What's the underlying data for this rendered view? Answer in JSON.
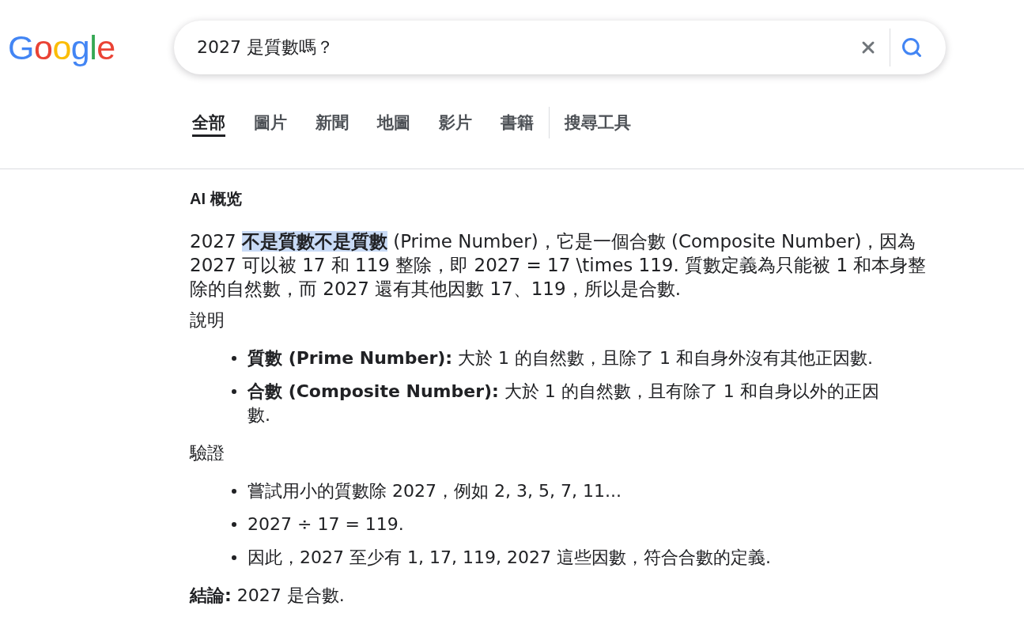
{
  "header": {
    "logo": "Google",
    "search": {
      "value": "2027 是質數嗎？"
    }
  },
  "tabs": [
    {
      "label": "全部",
      "kind": "category",
      "selected": true
    },
    {
      "label": "圖片",
      "kind": "category",
      "selected": false
    },
    {
      "label": "新聞",
      "kind": "category",
      "selected": false
    },
    {
      "label": "地圖",
      "kind": "category",
      "selected": false
    },
    {
      "label": "影片",
      "kind": "category",
      "selected": false
    },
    {
      "label": "書籍",
      "kind": "category",
      "selected": false
    },
    {
      "label": "搜尋工具",
      "kind": "tools",
      "selected": false
    }
  ],
  "ai_overview": {
    "title": "AI 概览",
    "summary": {
      "text": "2027 **不是質數不是質數** (Prime Number)，它是一個合數 (Composite Number)，因為 2027 可以被 17 和 119 整除，即 2027 = 17 \\times 119. 質數定義為只能被 1 和本身整除的自然數，而 2027 還有其他因數 17、119，所以是合數.",
      "highlighted": true
    },
    "sections": [
      {
        "heading": "說明",
        "items": [
          "**質數 (Prime Number):** 大於 1 的自然數，且除了 1 和自身外沒有其他正因數.",
          "**合數 (Composite Number):** 大於 1 的自然數，且有除了 1 和自身以外的正因數."
        ]
      },
      {
        "heading": "驗證",
        "items": [
          "嘗試用小的質數除 2027，例如 2, 3, 5, 7, 11...",
          "2027 ÷ 17 = 119.",
          "因此，2027 至少有 1, 17, 119, 2027 這些因數，符合合數的定義."
        ]
      }
    ],
    "conclusion": "**結論:** 2027 是合數."
  }
}
